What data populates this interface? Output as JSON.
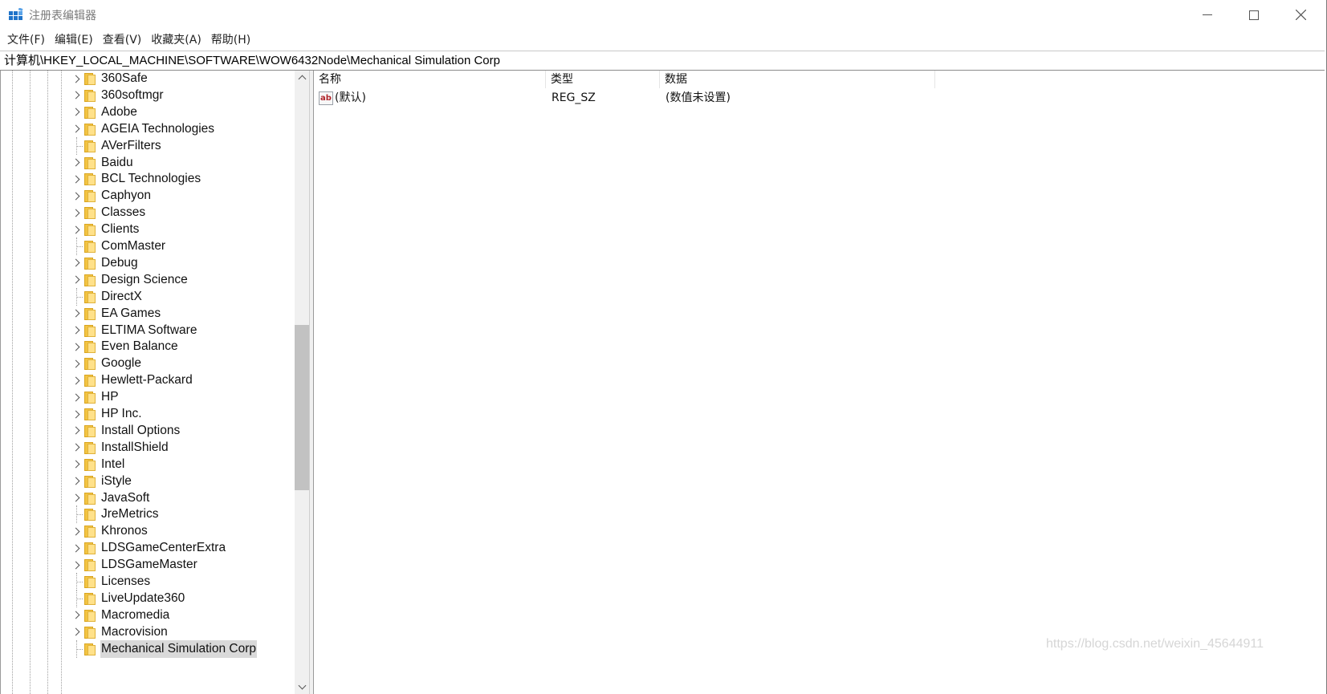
{
  "window": {
    "title": "注册表编辑器",
    "icon": "regedit-icon"
  },
  "menu": [
    {
      "label": "文件(F)"
    },
    {
      "label": "编辑(E)"
    },
    {
      "label": "查看(V)"
    },
    {
      "label": "收藏夹(A)"
    },
    {
      "label": "帮助(H)"
    }
  ],
  "address": {
    "path": "计算机\\HKEY_LOCAL_MACHINE\\SOFTWARE\\WOW6432Node\\Mechanical Simulation Corp"
  },
  "tree": {
    "items": [
      {
        "label": "360Safe",
        "expandable": true
      },
      {
        "label": "360softmgr",
        "expandable": true
      },
      {
        "label": "Adobe",
        "expandable": true
      },
      {
        "label": "AGEIA Technologies",
        "expandable": true
      },
      {
        "label": "AVerFilters",
        "expandable": false
      },
      {
        "label": "Baidu",
        "expandable": true
      },
      {
        "label": "BCL Technologies",
        "expandable": true
      },
      {
        "label": "Caphyon",
        "expandable": true
      },
      {
        "label": "Classes",
        "expandable": true
      },
      {
        "label": "Clients",
        "expandable": true
      },
      {
        "label": "ComMaster",
        "expandable": false
      },
      {
        "label": "Debug",
        "expandable": true
      },
      {
        "label": "Design Science",
        "expandable": true
      },
      {
        "label": "DirectX",
        "expandable": false
      },
      {
        "label": "EA Games",
        "expandable": true
      },
      {
        "label": "ELTIMA Software",
        "expandable": true
      },
      {
        "label": "Even Balance",
        "expandable": true
      },
      {
        "label": "Google",
        "expandable": true
      },
      {
        "label": "Hewlett-Packard",
        "expandable": true
      },
      {
        "label": "HP",
        "expandable": true
      },
      {
        "label": "HP Inc.",
        "expandable": true
      },
      {
        "label": "Install Options",
        "expandable": true
      },
      {
        "label": "InstallShield",
        "expandable": true
      },
      {
        "label": "Intel",
        "expandable": true
      },
      {
        "label": "iStyle",
        "expandable": true
      },
      {
        "label": "JavaSoft",
        "expandable": true
      },
      {
        "label": "JreMetrics",
        "expandable": false
      },
      {
        "label": "Khronos",
        "expandable": true
      },
      {
        "label": "LDSGameCenterExtra",
        "expandable": true
      },
      {
        "label": "LDSGameMaster",
        "expandable": true
      },
      {
        "label": "Licenses",
        "expandable": false
      },
      {
        "label": "LiveUpdate360",
        "expandable": false
      },
      {
        "label": "Macromedia",
        "expandable": true
      },
      {
        "label": "Macrovision",
        "expandable": true
      },
      {
        "label": "Mechanical Simulation Corp",
        "expandable": false,
        "selected": true
      }
    ]
  },
  "values": {
    "columns": [
      {
        "label": "名称"
      },
      {
        "label": "类型"
      },
      {
        "label": "数据"
      }
    ],
    "rows": [
      {
        "icon": "string-value-icon",
        "icon_text": "ab",
        "name": "(默认)",
        "type": "REG_SZ",
        "data": "(数值未设置)"
      }
    ]
  },
  "watermark": "https://blog.csdn.net/weixin_45644911",
  "colors": {
    "folder": "#f3c443",
    "selection": "#d9d9d9",
    "scroll_thumb": "#c2c2c2"
  }
}
